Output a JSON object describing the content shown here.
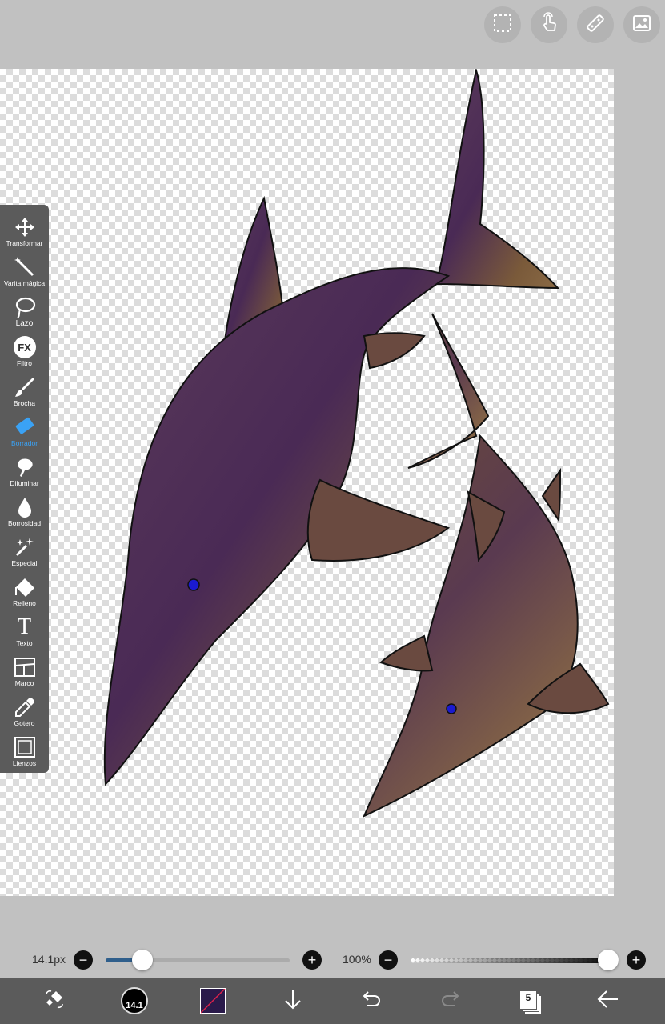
{
  "top_buttons": [
    {
      "name": "selection",
      "icon": "dashed-square-icon"
    },
    {
      "name": "gesture",
      "icon": "hand-pointer-icon"
    },
    {
      "name": "ruler",
      "icon": "ruler-icon"
    },
    {
      "name": "gallery",
      "icon": "image-icon"
    }
  ],
  "tools": [
    {
      "label": "Transformar",
      "icon": "move-arrows-icon"
    },
    {
      "label": "Varita mágica",
      "icon": "magic-wand-icon"
    },
    {
      "label": "Lazo",
      "icon": "lasso-icon"
    },
    {
      "label": "Filtro",
      "icon": "fx-icon",
      "glyph": "FX"
    },
    {
      "label": "Brocha",
      "icon": "brush-icon"
    },
    {
      "label": "Borrador",
      "icon": "eraser-icon",
      "active": true
    },
    {
      "label": "Difuminar",
      "icon": "smudge-icon"
    },
    {
      "label": "Borrosidad",
      "icon": "blur-drop-icon"
    },
    {
      "label": "Especial",
      "icon": "sparkle-brush-icon"
    },
    {
      "label": "Relleno",
      "icon": "fill-bucket-icon"
    },
    {
      "label": "Texto",
      "icon": "text-icon",
      "glyph": "T"
    },
    {
      "label": "Marco",
      "icon": "frame-icon"
    },
    {
      "label": "Gotero",
      "icon": "eyedropper-icon"
    },
    {
      "label": "Lienzos",
      "icon": "canvas-icon"
    }
  ],
  "brush_size": {
    "label": "14.1px",
    "minus": "−",
    "plus": "+",
    "fraction": 0.2
  },
  "opacity": {
    "label": "100%",
    "minus": "−",
    "plus": "+",
    "fraction": 1.0
  },
  "bottom_bar": {
    "brush_preview_value": "14.1",
    "layers_count": "5",
    "primary_color": "#2a1a4a",
    "secondary_color": "#e0204a"
  },
  "colors": {
    "toolbar_bg": "#5b5b5b",
    "accent": "#3aa2f5",
    "slider_fill": "#2f5f8c",
    "dolphin_body": "#6b4a3a",
    "dolphin_shade": "#3e2450",
    "eye": "#1a1ad0"
  }
}
